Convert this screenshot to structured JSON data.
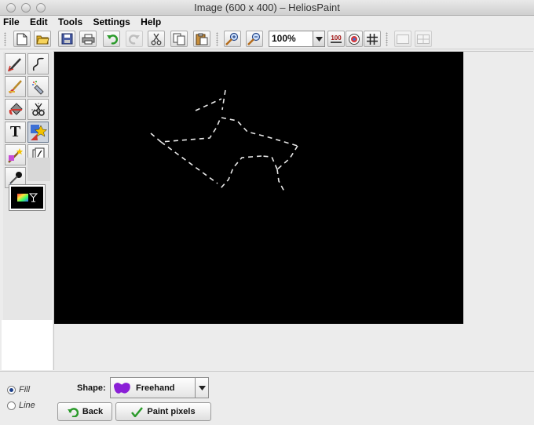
{
  "window": {
    "title": "Image (600 x 400) – HeliosPaint"
  },
  "menu": [
    "File",
    "Edit",
    "Tools",
    "Settings",
    "Help"
  ],
  "toolbar": {
    "zoom_value": "100%",
    "actual_size_label": "100",
    "buttons": [
      "new-file",
      "open-folder",
      "save",
      "print",
      "undo",
      "redo",
      "cut",
      "copy",
      "paste",
      "zoom-in",
      "zoom-out",
      "actual-size",
      "center",
      "grid",
      "view-single",
      "view-split"
    ]
  },
  "palette": {
    "tools": [
      "pencil",
      "curve",
      "brush",
      "spray",
      "fill-bucket",
      "scissors",
      "text",
      "shapes",
      "effects",
      "clone-stamp",
      "color-picker"
    ],
    "selected_tool": "shapes"
  },
  "canvas": {
    "width": 600,
    "height": 400,
    "background": "#000000",
    "stroke_color": "#ffffff"
  },
  "options": {
    "fill_label": "Fill",
    "line_label": "Line",
    "selected_mode": "Fill",
    "shape_label": "Shape:",
    "shape_value": "Freehand",
    "back_label": "Back",
    "paint_label": "Paint pixels"
  },
  "colors": {
    "accent_green": "#2a9a2a",
    "shape_purple": "#8a1fd6"
  }
}
